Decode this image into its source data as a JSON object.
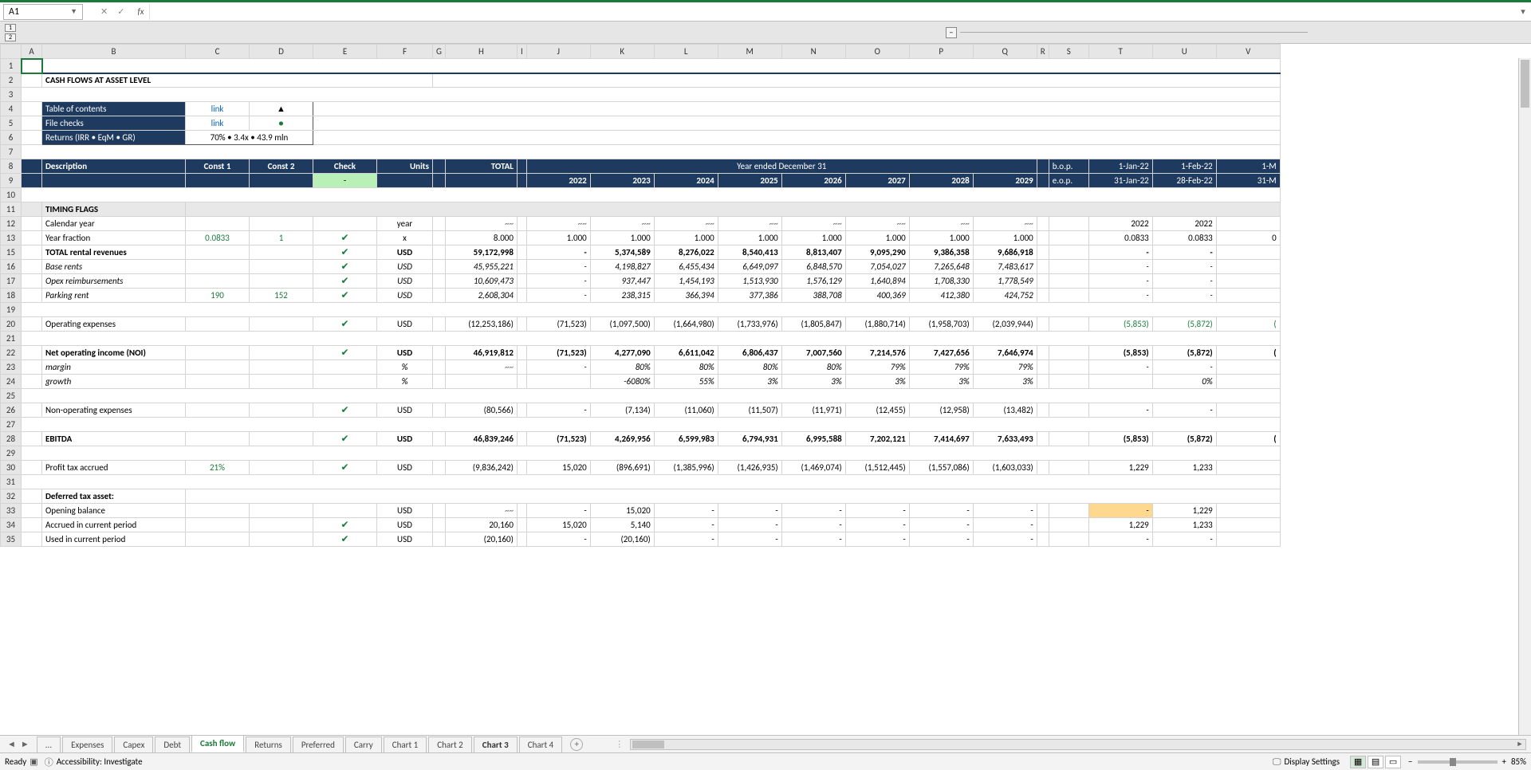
{
  "name_box": "A1",
  "fx_label": "fx",
  "outline_levels": [
    "1",
    "2"
  ],
  "outline_toggle": "−",
  "columns": [
    "",
    "A",
    "B",
    "C",
    "D",
    "E",
    "F",
    "G",
    "H",
    "I",
    "J",
    "K",
    "L",
    "M",
    "N",
    "O",
    "P",
    "Q",
    "R",
    "S",
    "T",
    "U",
    "V"
  ],
  "title": "CASH FLOWS AT ASSET LEVEL",
  "toc_label": "Table of contents",
  "toc_link": "link",
  "toc_arrow": "▲",
  "fc_label": "File checks",
  "fc_link": "link",
  "fc_dot": "●",
  "ret_label": "Returns (IRR • EqM • GR)",
  "ret_val": "70% • 3.4x • 43.9 mln",
  "hdr": {
    "desc": "Description",
    "c1": "Const 1",
    "c2": "Const 2",
    "check": "Check",
    "units": "Units",
    "total": "TOTAL",
    "year_ended": "Year ended December 31",
    "bop": "b.o.p.",
    "eop": "e.o.p."
  },
  "years": [
    "2022",
    "2023",
    "2024",
    "2025",
    "2026",
    "2027",
    "2028",
    "2029"
  ],
  "bop_dates": [
    "1-Jan-22",
    "1-Feb-22",
    "1-M"
  ],
  "eop_dates": [
    "31-Jan-22",
    "28-Feb-22",
    "31-M"
  ],
  "check_dash": "-",
  "sections": {
    "timing": "TIMING FLAGS",
    "cal_year": "Calendar year",
    "year_frac": "Year fraction",
    "total_rev": "TOTAL rental revenues",
    "base": "Base rents",
    "opexr": "Opex reimbursements",
    "park": "Parking rent",
    "opex": "Operating expenses",
    "noi": "Net operating income (NOI)",
    "margin": "margin",
    "growth": "growth",
    "nonop": "Non-operating expenses",
    "ebitda": "EBITDA",
    "ptax": "Profit tax accrued",
    "dta": "Deferred tax asset:",
    "open": "Opening balance",
    "accr": "Accrued in current period",
    "used": "Used in current period"
  },
  "units": {
    "year": "year",
    "x": "x",
    "usd": "USD",
    "pct": "%"
  },
  "consts": {
    "yf1": "0.0833",
    "yf2": "1",
    "park1": "190",
    "park2": "152",
    "tax": "21%"
  },
  "totals": {
    "yf": "8.000",
    "rev": "59,172,998",
    "base": "45,955,221",
    "opexr": "10,609,473",
    "park": "2,608,304",
    "opex": "(12,253,186)",
    "noi": "46,919,812",
    "nonop": "(80,566)",
    "ebitda": "46,839,246",
    "ptax": "(9,836,242)",
    "accr": "20,160",
    "used": "(20,160)"
  },
  "chart_data": {
    "type": "table",
    "row_headers": [
      "Calendar year",
      "Year fraction",
      "TOTAL rental revenues",
      "Base rents",
      "Opex reimbursements",
      "Parking rent",
      "Operating expenses",
      "Net operating income (NOI)",
      "margin",
      "growth",
      "Non-operating expenses",
      "EBITDA",
      "Profit tax accrued",
      "Opening balance",
      "Accrued in current period",
      "Used in current period"
    ],
    "year": [
      "~~",
      "~~",
      "~~",
      "~~",
      "~~",
      "~~",
      "~~",
      "~~"
    ],
    "yf": [
      "1.000",
      "1.000",
      "1.000",
      "1.000",
      "1.000",
      "1.000",
      "1.000",
      "1.000"
    ],
    "rev": [
      "-",
      "5,374,589",
      "8,276,022",
      "8,540,413",
      "8,813,407",
      "9,095,290",
      "9,386,358",
      "9,686,918"
    ],
    "base": [
      "-",
      "4,198,827",
      "6,455,434",
      "6,649,097",
      "6,848,570",
      "7,054,027",
      "7,265,648",
      "7,483,617"
    ],
    "opexr": [
      "-",
      "937,447",
      "1,454,193",
      "1,513,930",
      "1,576,129",
      "1,640,894",
      "1,708,330",
      "1,778,549"
    ],
    "park": [
      "-",
      "238,315",
      "366,394",
      "377,386",
      "388,708",
      "400,369",
      "412,380",
      "424,752"
    ],
    "opex": [
      "(71,523)",
      "(1,097,500)",
      "(1,664,980)",
      "(1,733,976)",
      "(1,805,847)",
      "(1,880,714)",
      "(1,958,703)",
      "(2,039,944)"
    ],
    "noi": [
      "(71,523)",
      "4,277,090",
      "6,611,042",
      "6,806,437",
      "7,007,560",
      "7,214,576",
      "7,427,656",
      "7,646,974"
    ],
    "margin": [
      "-",
      "80%",
      "80%",
      "80%",
      "80%",
      "79%",
      "79%",
      "79%"
    ],
    "growth": [
      "",
      "-6080%",
      "55%",
      "3%",
      "3%",
      "3%",
      "3%",
      "3%"
    ],
    "nonop": [
      "-",
      "(7,134)",
      "(11,060)",
      "(11,507)",
      "(11,971)",
      "(12,455)",
      "(12,958)",
      "(13,482)"
    ],
    "ebitda": [
      "(71,523)",
      "4,269,956",
      "6,599,983",
      "6,794,931",
      "6,995,588",
      "7,202,121",
      "7,414,697",
      "7,633,493"
    ],
    "ptax": [
      "15,020",
      "(896,691)",
      "(1,385,996)",
      "(1,426,935)",
      "(1,469,074)",
      "(1,512,445)",
      "(1,557,086)",
      "(1,603,033)"
    ],
    "open": [
      "-",
      "15,020",
      "-",
      "-",
      "-",
      "-",
      "-",
      "-"
    ],
    "accr": [
      "15,020",
      "5,140",
      "-",
      "-",
      "-",
      "-",
      "-",
      "-"
    ],
    "used": [
      "-",
      "(20,160)",
      "-",
      "-",
      "-",
      "-",
      "-",
      "-"
    ],
    "monthly": {
      "cal_year": [
        "2022",
        "2022"
      ],
      "yf": [
        "0.0833",
        "0.0833",
        "0"
      ],
      "rev": [
        "-",
        "-"
      ],
      "base": [
        "-",
        "-"
      ],
      "opexr": [
        "-",
        "-"
      ],
      "park": [
        "-",
        "-"
      ],
      "opex": [
        "(5,853)",
        "(5,872)",
        "("
      ],
      "noi": [
        "(5,853)",
        "(5,872)",
        "("
      ],
      "margin": [
        "-",
        "-"
      ],
      "growth": [
        "",
        "0%"
      ],
      "nonop": [
        "-",
        "-"
      ],
      "ebitda": [
        "(5,853)",
        "(5,872)",
        "("
      ],
      "ptax": [
        "1,229",
        "1,233"
      ],
      "open": [
        "-",
        "1,229"
      ],
      "accr": [
        "1,229",
        "1,233"
      ],
      "used": [
        "-",
        "-"
      ]
    }
  },
  "tabs": [
    "...",
    "Expenses",
    "Capex",
    "Debt",
    "Cash flow",
    "Returns",
    "Preferred",
    "Carry",
    "Chart 1",
    "Chart 2",
    "Chart 3",
    "Chart 4"
  ],
  "active_tab": "Cash flow",
  "bold_tabs": [
    "Chart 3"
  ],
  "status": {
    "ready": "Ready",
    "acc": "Accessibility: Investigate",
    "disp": "Display Settings",
    "zoom": "85%"
  }
}
